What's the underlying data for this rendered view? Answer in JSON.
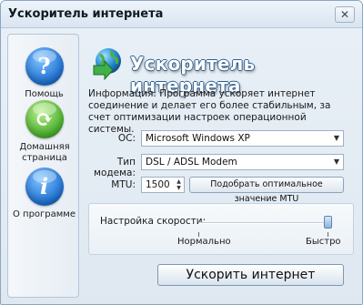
{
  "window": {
    "title": "Ускоритель интернета",
    "close_glyph": "✕"
  },
  "sidebar": {
    "items": [
      {
        "label": "Помощь",
        "icon": "help-icon",
        "glyph": "?",
        "color": "#1e6fd0"
      },
      {
        "label": "Домашняя страница",
        "icon": "home-refresh-icon",
        "glyph": "⟳",
        "color": "#4ab02c"
      },
      {
        "label": "О программе",
        "icon": "info-icon",
        "glyph": "i",
        "color": "#1e6fd0"
      }
    ]
  },
  "header": {
    "title": "Ускоритель интернета",
    "icon": "globe-arrow-icon"
  },
  "info_text": "Информация: Программа ускоряет интернет соединение и делает его более стабильным, за счет оптимизации настроек операционной системы.",
  "form": {
    "os_label": "ОС:",
    "os_value": "Microsoft Windows XP",
    "modem_label": "Тип модема:",
    "modem_value": "DSL / ADSL Modem",
    "mtu_label": "MTU:",
    "mtu_value": "1500",
    "optimize_mtu_button": "Подобрать оптимальное значение MTU"
  },
  "speed": {
    "label": "Настройка скорости:",
    "min_label": "Нормально",
    "max_label": "Быстро",
    "level": 1.0
  },
  "accelerate_button": "Ускорить интернет",
  "colors": {
    "accent_blue": "#1e6fd0",
    "accent_green": "#4ab02c",
    "title_outline": "#2d5f8f"
  }
}
